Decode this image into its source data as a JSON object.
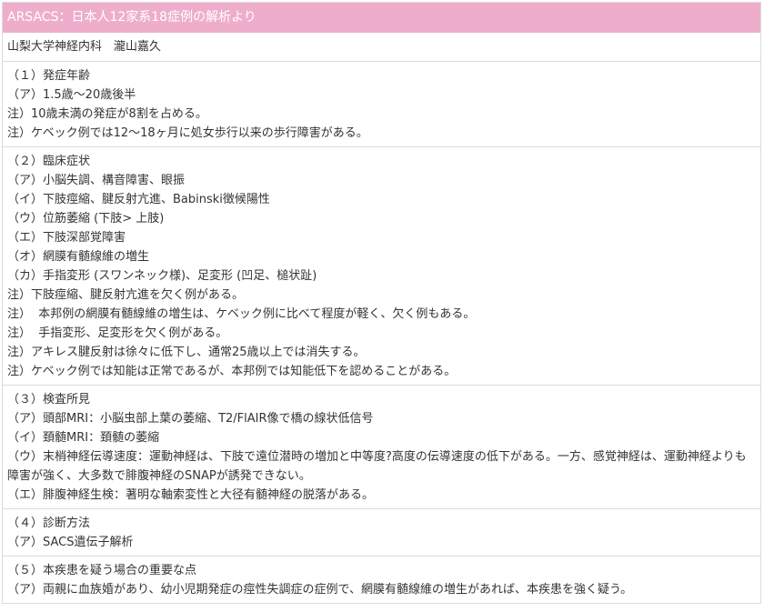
{
  "title": "ARSACS：日本人12家系18症例の解析より",
  "author": "山梨大学神経内科　瀧山嘉久",
  "colors": {
    "title_bg": "#eeaecb",
    "title_text": "#ffffff",
    "border": "#dcdcdc",
    "text": "#333333"
  },
  "sections": [
    {
      "lines": [
        "（１）発症年齢",
        "（ア）1.5歳～20歳後半",
        "注）10歳未満の発症が8割を占める。",
        "注）ケベック例では12～18ヶ月に処女歩行以来の歩行障害がある。"
      ]
    },
    {
      "lines": [
        "（２）臨床症状",
        "（ア）小脳失調、構音障害、眼振",
        "（イ）下肢痙縮、腱反射亢進、Babinski徴候陽性",
        "（ウ）位筋萎縮 (下肢> 上肢)",
        "（エ）下肢深部覚障害",
        "（オ）網膜有髄線維の増生",
        "（カ）手指変形 (スワンネック様)、足変形 (凹足、槌状趾)",
        "注）下肢痙縮、腱反射亢進を欠く例がある。",
        "注）  本邦例の網膜有髄線維の増生は、ケベック例に比べて程度が軽く、欠く例もある。",
        "注）  手指変形、足変形を欠く例がある。",
        "注）アキレス腱反射は徐々に低下し、通常25歳以上では消失する。",
        "注）ケベック例では知能は正常であるが、本邦例では知能低下を認めることがある。"
      ]
    },
    {
      "lines": [
        "（３）検査所見",
        "（ア）頭部MRI：小脳虫部上葉の萎縮、T2/FlAIR像で橋の線状低信号",
        "（イ）頚髄MRI：頚髄の萎縮",
        "（ウ）末梢神経伝導速度：運動神経は、下肢で遠位潜時の増加と中等度?高度の伝導速度の低下がある。一方、感覚神経は、運動神経よりも障害が強く、大多数で腓腹神経のSNAPが誘発できない。",
        "（エ）腓腹神経生検：著明な軸索変性と大径有髄神経の脱落がある。"
      ]
    },
    {
      "lines": [
        "（４）診断方法",
        "（ア）SACS遺伝子解析"
      ]
    },
    {
      "lines": [
        "（５）本疾患を疑う場合の重要な点",
        "（ア）両親に血族婚があり、幼小児期発症の痙性失調症の症例で、網膜有髄線維の増生があれば、本疾患を強く疑う。"
      ]
    }
  ]
}
